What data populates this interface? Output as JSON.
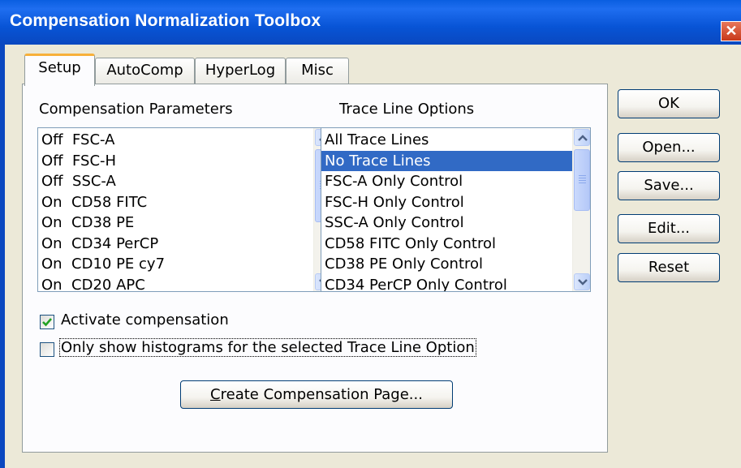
{
  "window": {
    "title": "Compensation Normalization Toolbox",
    "close_glyph": "✕"
  },
  "tabs": [
    {
      "label": "Setup",
      "active": true
    },
    {
      "label": "AutoComp",
      "active": false
    },
    {
      "label": "HyperLog",
      "active": false
    },
    {
      "label": "Misc",
      "active": false
    }
  ],
  "setup": {
    "compensation_parameters": {
      "label": "Compensation Parameters",
      "items": [
        "Off  FSC-A",
        "Off  FSC-H",
        "Off  SSC-A",
        "On  CD58 FITC",
        "On  CD38 PE",
        "On  CD34 PerCP",
        "On  CD10 PE cy7",
        "On  CD20 APC"
      ]
    },
    "trace_line_options": {
      "label": "Trace Line Options",
      "items": [
        "All Trace Lines",
        "No Trace Lines",
        "FSC-A Only Control",
        "FSC-H Only Control",
        "SSC-A Only Control",
        "CD58 FITC Only Control",
        "CD38 PE Only Control",
        "CD34 PerCP Only Control"
      ],
      "selected_index": 1
    },
    "activate_compensation": {
      "label": "Activate compensation",
      "checked": true
    },
    "only_show_histograms": {
      "label": "Only show histograms for the selected Trace Line Option",
      "checked": false
    },
    "create_page_button": {
      "label_prefix": "C",
      "label_rest": "reate Compensation Page..."
    }
  },
  "side_buttons": {
    "ok": "OK",
    "open": "Open...",
    "save": "Save...",
    "edit": "Edit...",
    "reset": "Reset"
  },
  "colors": {
    "titlebar": "#0a5ee0",
    "selection": "#316ac5",
    "check": "#21a121",
    "tab_highlight": "#f7b03a"
  }
}
